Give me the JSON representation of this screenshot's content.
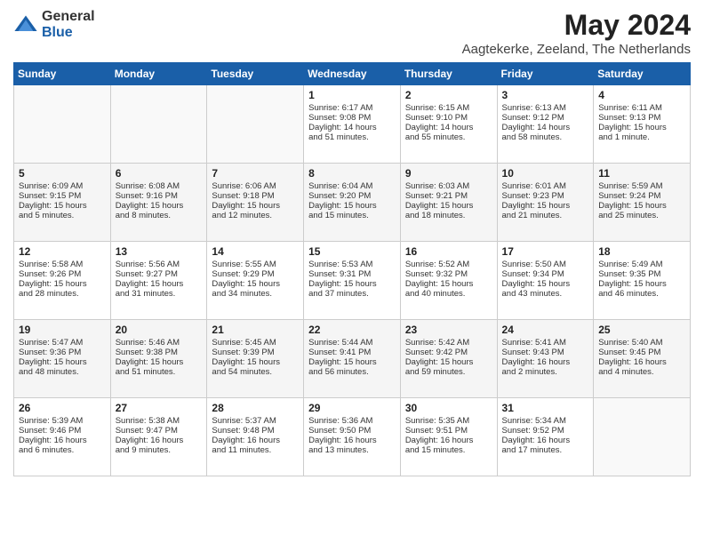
{
  "logo": {
    "general": "General",
    "blue": "Blue"
  },
  "title": "May 2024",
  "subtitle": "Aagtekerke, Zeeland, The Netherlands",
  "weekdays": [
    "Sunday",
    "Monday",
    "Tuesday",
    "Wednesday",
    "Thursday",
    "Friday",
    "Saturday"
  ],
  "weeks": [
    [
      {
        "day": "",
        "info": ""
      },
      {
        "day": "",
        "info": ""
      },
      {
        "day": "",
        "info": ""
      },
      {
        "day": "1",
        "info": "Sunrise: 6:17 AM\nSunset: 9:08 PM\nDaylight: 14 hours\nand 51 minutes."
      },
      {
        "day": "2",
        "info": "Sunrise: 6:15 AM\nSunset: 9:10 PM\nDaylight: 14 hours\nand 55 minutes."
      },
      {
        "day": "3",
        "info": "Sunrise: 6:13 AM\nSunset: 9:12 PM\nDaylight: 14 hours\nand 58 minutes."
      },
      {
        "day": "4",
        "info": "Sunrise: 6:11 AM\nSunset: 9:13 PM\nDaylight: 15 hours\nand 1 minute."
      }
    ],
    [
      {
        "day": "5",
        "info": "Sunrise: 6:09 AM\nSunset: 9:15 PM\nDaylight: 15 hours\nand 5 minutes."
      },
      {
        "day": "6",
        "info": "Sunrise: 6:08 AM\nSunset: 9:16 PM\nDaylight: 15 hours\nand 8 minutes."
      },
      {
        "day": "7",
        "info": "Sunrise: 6:06 AM\nSunset: 9:18 PM\nDaylight: 15 hours\nand 12 minutes."
      },
      {
        "day": "8",
        "info": "Sunrise: 6:04 AM\nSunset: 9:20 PM\nDaylight: 15 hours\nand 15 minutes."
      },
      {
        "day": "9",
        "info": "Sunrise: 6:03 AM\nSunset: 9:21 PM\nDaylight: 15 hours\nand 18 minutes."
      },
      {
        "day": "10",
        "info": "Sunrise: 6:01 AM\nSunset: 9:23 PM\nDaylight: 15 hours\nand 21 minutes."
      },
      {
        "day": "11",
        "info": "Sunrise: 5:59 AM\nSunset: 9:24 PM\nDaylight: 15 hours\nand 25 minutes."
      }
    ],
    [
      {
        "day": "12",
        "info": "Sunrise: 5:58 AM\nSunset: 9:26 PM\nDaylight: 15 hours\nand 28 minutes."
      },
      {
        "day": "13",
        "info": "Sunrise: 5:56 AM\nSunset: 9:27 PM\nDaylight: 15 hours\nand 31 minutes."
      },
      {
        "day": "14",
        "info": "Sunrise: 5:55 AM\nSunset: 9:29 PM\nDaylight: 15 hours\nand 34 minutes."
      },
      {
        "day": "15",
        "info": "Sunrise: 5:53 AM\nSunset: 9:31 PM\nDaylight: 15 hours\nand 37 minutes."
      },
      {
        "day": "16",
        "info": "Sunrise: 5:52 AM\nSunset: 9:32 PM\nDaylight: 15 hours\nand 40 minutes."
      },
      {
        "day": "17",
        "info": "Sunrise: 5:50 AM\nSunset: 9:34 PM\nDaylight: 15 hours\nand 43 minutes."
      },
      {
        "day": "18",
        "info": "Sunrise: 5:49 AM\nSunset: 9:35 PM\nDaylight: 15 hours\nand 46 minutes."
      }
    ],
    [
      {
        "day": "19",
        "info": "Sunrise: 5:47 AM\nSunset: 9:36 PM\nDaylight: 15 hours\nand 48 minutes."
      },
      {
        "day": "20",
        "info": "Sunrise: 5:46 AM\nSunset: 9:38 PM\nDaylight: 15 hours\nand 51 minutes."
      },
      {
        "day": "21",
        "info": "Sunrise: 5:45 AM\nSunset: 9:39 PM\nDaylight: 15 hours\nand 54 minutes."
      },
      {
        "day": "22",
        "info": "Sunrise: 5:44 AM\nSunset: 9:41 PM\nDaylight: 15 hours\nand 56 minutes."
      },
      {
        "day": "23",
        "info": "Sunrise: 5:42 AM\nSunset: 9:42 PM\nDaylight: 15 hours\nand 59 minutes."
      },
      {
        "day": "24",
        "info": "Sunrise: 5:41 AM\nSunset: 9:43 PM\nDaylight: 16 hours\nand 2 minutes."
      },
      {
        "day": "25",
        "info": "Sunrise: 5:40 AM\nSunset: 9:45 PM\nDaylight: 16 hours\nand 4 minutes."
      }
    ],
    [
      {
        "day": "26",
        "info": "Sunrise: 5:39 AM\nSunset: 9:46 PM\nDaylight: 16 hours\nand 6 minutes."
      },
      {
        "day": "27",
        "info": "Sunrise: 5:38 AM\nSunset: 9:47 PM\nDaylight: 16 hours\nand 9 minutes."
      },
      {
        "day": "28",
        "info": "Sunrise: 5:37 AM\nSunset: 9:48 PM\nDaylight: 16 hours\nand 11 minutes."
      },
      {
        "day": "29",
        "info": "Sunrise: 5:36 AM\nSunset: 9:50 PM\nDaylight: 16 hours\nand 13 minutes."
      },
      {
        "day": "30",
        "info": "Sunrise: 5:35 AM\nSunset: 9:51 PM\nDaylight: 16 hours\nand 15 minutes."
      },
      {
        "day": "31",
        "info": "Sunrise: 5:34 AM\nSunset: 9:52 PM\nDaylight: 16 hours\nand 17 minutes."
      },
      {
        "day": "",
        "info": ""
      }
    ]
  ]
}
